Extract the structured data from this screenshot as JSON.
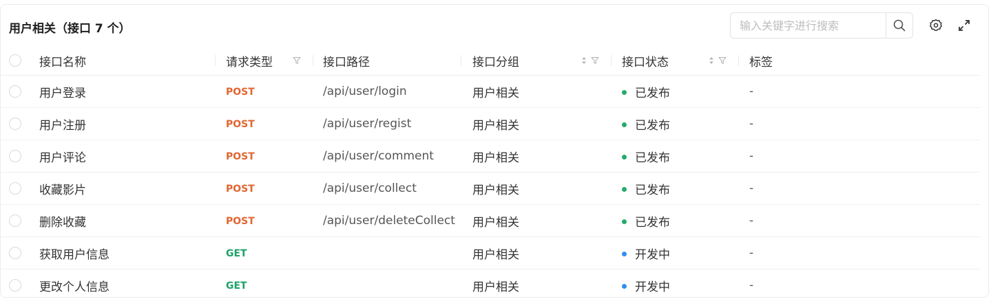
{
  "header": {
    "title": "用户相关（接口 7 个）",
    "search_placeholder": "输入关键字进行搜索"
  },
  "icons": {
    "search": "search-icon",
    "settings": "gear-icon",
    "fullscreen": "expand-icon",
    "sort": "sort-icon",
    "filter": "filter-icon"
  },
  "colors": {
    "post": "#e06631",
    "get": "#1da168",
    "status_published": "#27a96c",
    "status_developing": "#2f8ef0"
  },
  "columns": [
    "接口名称",
    "请求类型",
    "接口路径",
    "接口分组",
    "接口状态",
    "标签"
  ],
  "rows": [
    {
      "name": "用户登录",
      "method": "POST",
      "path": "/api/user/login",
      "group": "用户相关",
      "status": "已发布",
      "tag": "-"
    },
    {
      "name": "用户注册",
      "method": "POST",
      "path": "/api/user/regist",
      "group": "用户相关",
      "status": "已发布",
      "tag": "-"
    },
    {
      "name": "用户评论",
      "method": "POST",
      "path": "/api/user/comment",
      "group": "用户相关",
      "status": "已发布",
      "tag": "-"
    },
    {
      "name": "收藏影片",
      "method": "POST",
      "path": "/api/user/collect",
      "group": "用户相关",
      "status": "已发布",
      "tag": "-"
    },
    {
      "name": "删除收藏",
      "method": "POST",
      "path": "/api/user/deleteCollect",
      "group": "用户相关",
      "status": "已发布",
      "tag": "-"
    },
    {
      "name": "获取用户信息",
      "method": "GET",
      "path": "",
      "group": "用户相关",
      "status": "开发中",
      "tag": "-"
    },
    {
      "name": "更改个人信息",
      "method": "GET",
      "path": "",
      "group": "用户相关",
      "status": "开发中",
      "tag": "-"
    }
  ]
}
